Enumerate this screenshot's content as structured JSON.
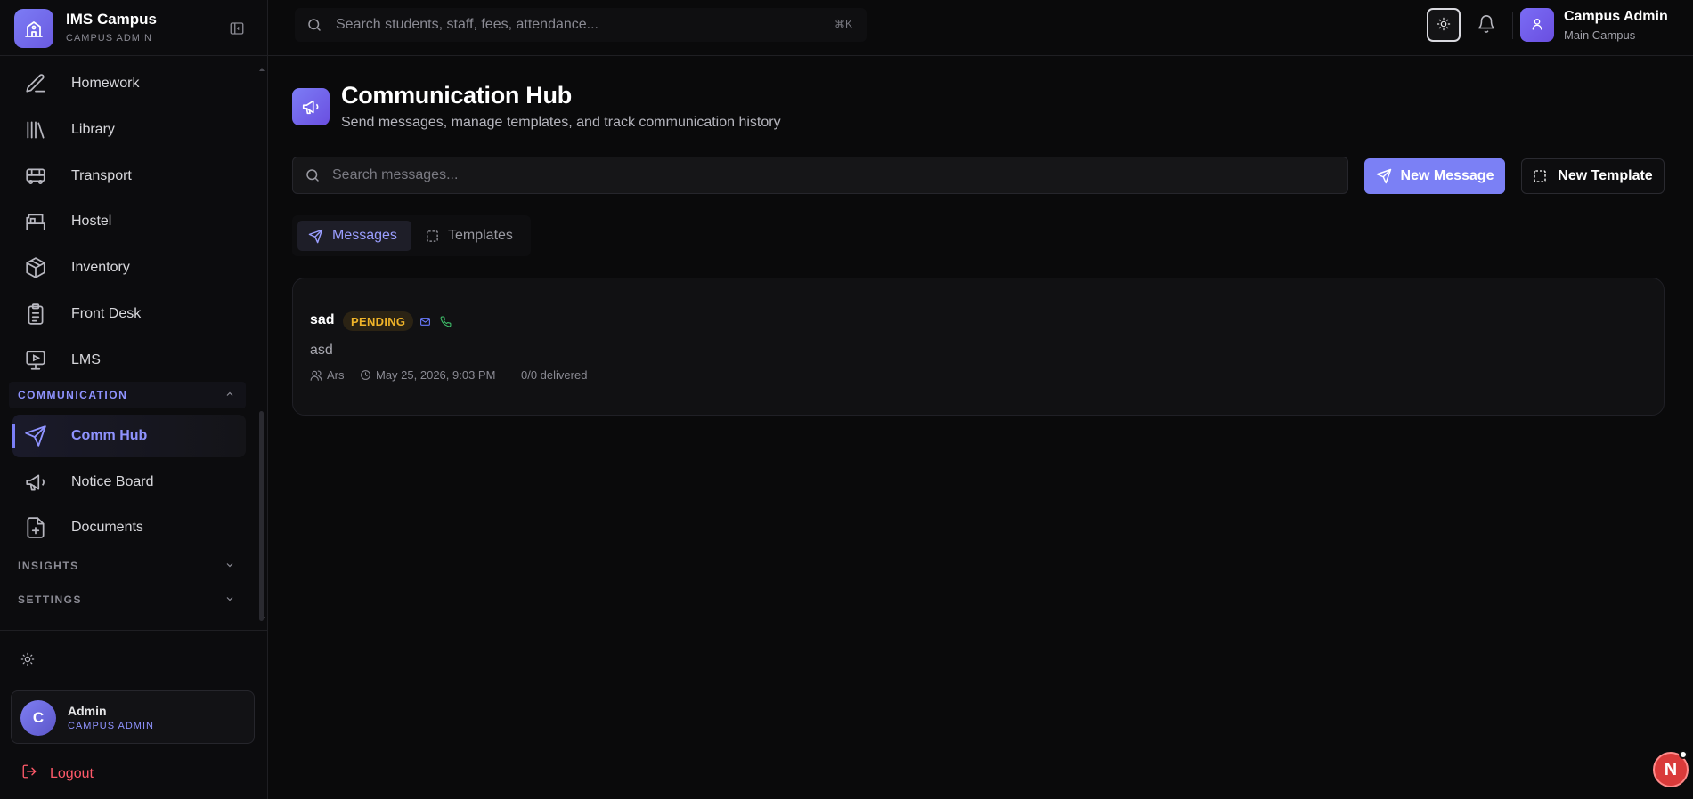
{
  "brand": {
    "title": "IMS Campus",
    "subtitle": "CAMPUS ADMIN"
  },
  "sidebar": {
    "items": [
      {
        "label": "Homework",
        "icon": "pencil-icon"
      },
      {
        "label": "Library",
        "icon": "library-icon"
      },
      {
        "label": "Transport",
        "icon": "bus-icon"
      },
      {
        "label": "Hostel",
        "icon": "bed-icon"
      },
      {
        "label": "Inventory",
        "icon": "box-icon"
      },
      {
        "label": "Front Desk",
        "icon": "clipboard-icon"
      },
      {
        "label": "LMS",
        "icon": "monitor-play-icon"
      }
    ],
    "communication_section": "COMMUNICATION",
    "communication_items": [
      {
        "label": "Comm Hub",
        "icon": "send-icon",
        "active": true
      },
      {
        "label": "Notice Board",
        "icon": "megaphone-icon"
      },
      {
        "label": "Documents",
        "icon": "file-plus-icon"
      }
    ],
    "insights_section": "INSIGHTS",
    "settings_section": "SETTINGS",
    "user": {
      "initial": "C",
      "name": "Admin",
      "role": "CAMPUS ADMIN"
    },
    "logout_label": "Logout"
  },
  "topbar": {
    "search_placeholder": "Search students, staff, fees, attendance...",
    "shortcut": "⌘K",
    "account_name": "Campus Admin",
    "account_sub": "Main Campus"
  },
  "page": {
    "title": "Communication Hub",
    "subtitle": "Send messages, manage templates, and track communication history",
    "search_placeholder": "Search messages...",
    "new_message_label": "New Message",
    "new_template_label": "New Template",
    "tabs": [
      {
        "label": "Messages",
        "active": true
      },
      {
        "label": "Templates",
        "active": false
      }
    ]
  },
  "messages": [
    {
      "title": "sad",
      "status": "PENDING",
      "body": "asd",
      "author": "Ars",
      "timestamp": "May 25, 2026, 9:03 PM",
      "delivery": "0/0 delivered"
    }
  ],
  "fab_letter": "N",
  "colors": {
    "accent": "#7b80f5",
    "pending": "#f0b429",
    "logout": "#ff5a6a",
    "background": "#0a0a0b"
  }
}
